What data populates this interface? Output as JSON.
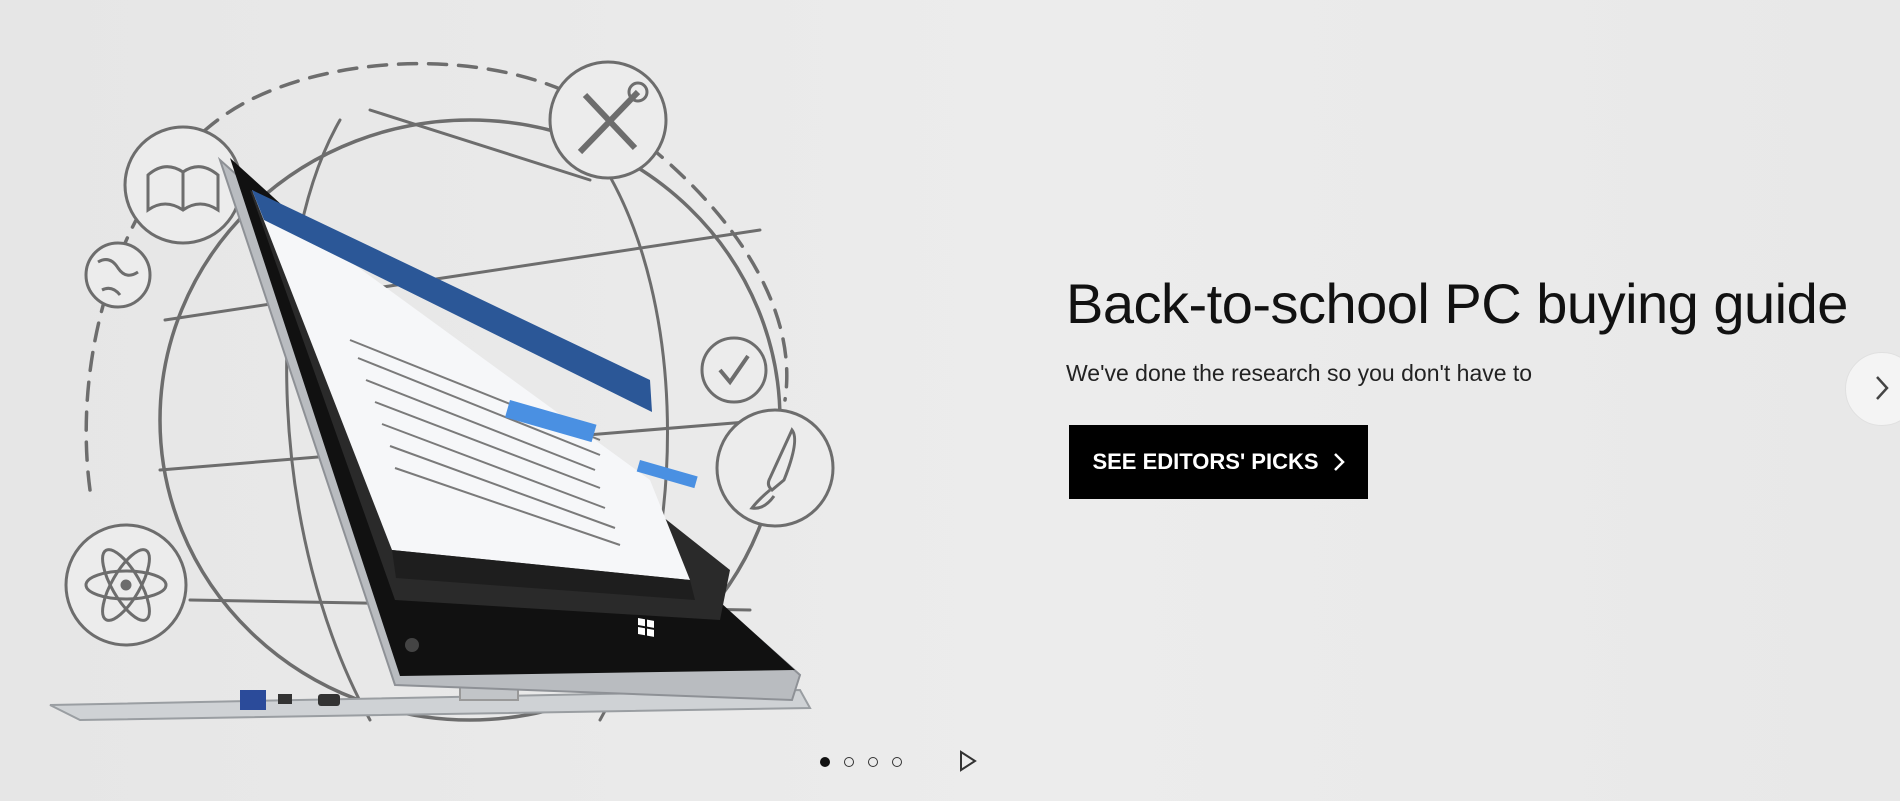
{
  "hero": {
    "title": "Back-to-school PC buying guide",
    "subtitle": "We've done the research so you don't have to",
    "cta_label": "SEE EDITORS' PICKS"
  },
  "carousel": {
    "slide_count": 4,
    "active_slide": 1,
    "icons": {
      "next": "chevron-right-icon",
      "play": "play-icon"
    }
  },
  "illustration": {
    "icons": [
      "book-icon",
      "tools-icon",
      "globe-icon",
      "checkmark-icon",
      "paintbrush-icon",
      "atom-icon",
      "laptop-icon"
    ]
  },
  "colors": {
    "background": "#e9e9e9",
    "cta_background": "#000000",
    "cta_text": "#ffffff",
    "title_text": "#111111"
  }
}
